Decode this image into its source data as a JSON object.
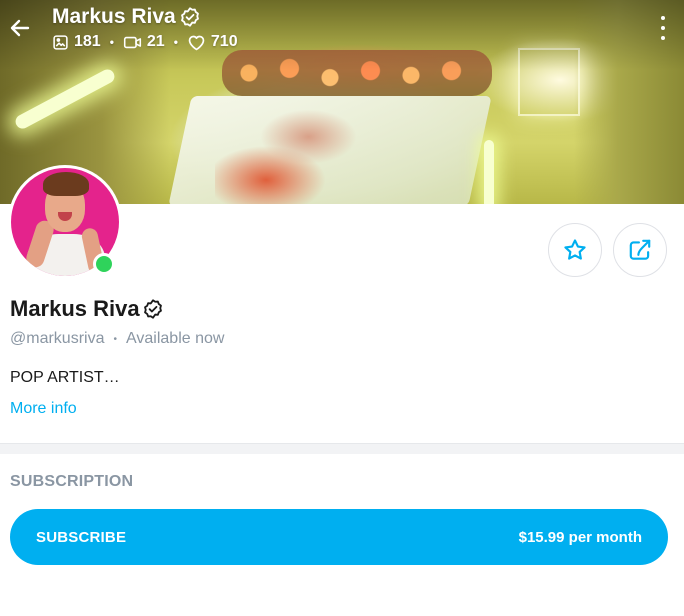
{
  "header": {
    "name": "Markus Riva",
    "stats": {
      "photos": "181",
      "videos": "21",
      "likes": "710"
    }
  },
  "profile": {
    "name": "Markus Riva",
    "handle": "@markusriva",
    "status": "Available now",
    "bio": "POP ARTIST…",
    "more_info": "More info",
    "verified": true,
    "online": true
  },
  "subscription": {
    "section_title": "SUBSCRIPTION",
    "button_label": "SUBSCRIBE",
    "price": "$15.99 per month"
  },
  "colors": {
    "accent": "#00aff0",
    "online": "#2fd35b",
    "muted_text": "#8a96a3"
  },
  "icons": {
    "back": "arrow-left-icon",
    "photos": "image-icon",
    "videos": "video-icon",
    "likes": "heart-icon",
    "more": "more-vertical-icon",
    "verified": "verified-badge-icon",
    "favorite": "star-icon",
    "share": "share-icon"
  }
}
